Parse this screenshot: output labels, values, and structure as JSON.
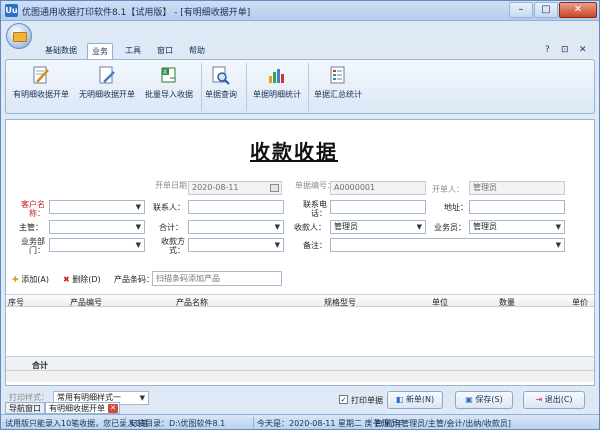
{
  "window": {
    "title": "优图通用收据打印软件8.1【试用版】 - [有明细收据开单]",
    "app_icon_text": "Uu",
    "minimize": "–",
    "maximize": "□",
    "close": "✕"
  },
  "ribbon_tabs": [
    "基础数据",
    "业务",
    "工具",
    "窗口",
    "帮助"
  ],
  "ribbon_right": {
    "help": "?",
    "restore": "⊡",
    "close": "✕"
  },
  "ribbon_buttons": [
    {
      "label": "有明细收据开单",
      "icon": "edit-document-icon"
    },
    {
      "label": "无明细收据开单",
      "icon": "blank-document-icon"
    },
    {
      "label": "批量导入收据",
      "icon": "excel-import-icon"
    },
    {
      "label": "单据查询",
      "icon": "document-search-icon"
    },
    {
      "label": "单据明细统计",
      "icon": "bar-chart-icon"
    },
    {
      "label": "单据汇总统计",
      "icon": "summary-list-icon"
    }
  ],
  "form": {
    "title": "收款收据",
    "date_label": "开单日期：",
    "date_value": "2020-08-11",
    "docno_label": "单据编号：",
    "docno_value": "A0000001",
    "creator_label": "开单人：",
    "creator_value": "管理员",
    "customer_label": "客户名称：",
    "customer_value": "",
    "contact_label": "联系人：",
    "phone_label": "联系电话：",
    "address_label": "地址：",
    "manager_label": "主管：",
    "total_label": "合计：",
    "payee_label": "收款人：",
    "payee_value": "管理员",
    "clerk_label": "业务员：",
    "clerk_value": "管理员",
    "dept_label": "业务部门：",
    "method_label": "收款方式：",
    "note_label": "备注："
  },
  "toolbar": {
    "add": "添加(A)",
    "delete": "删除(D)",
    "barcode_label": "产品条码：",
    "barcode_placeholder": "扫描条码添加产品"
  },
  "grid": {
    "columns": [
      "序号",
      "产品编号",
      "产品名称",
      "规格型号",
      "单位",
      "数量",
      "单价"
    ],
    "total_label": "合计"
  },
  "bottom": {
    "print_style_label": "打印样式：",
    "print_style_value": "常用有明细样式一",
    "print_checkbox": "打印单据",
    "new_btn": "新单(N)",
    "save_btn": "保存(S)",
    "exit_btn": "退出(C)"
  },
  "window_tabs": [
    "导航窗口",
    "有明细收据开单"
  ],
  "statusbar": {
    "trial": "试用版只能录入10笔收据，您已录入0笔",
    "install": "安装目录：D:\\优图软件8.1",
    "today": "今天是：2020-08-11 星期二 庚子(鼠)年",
    "user": "管理员[管理员/主管/会计/出纳/收款员]"
  }
}
